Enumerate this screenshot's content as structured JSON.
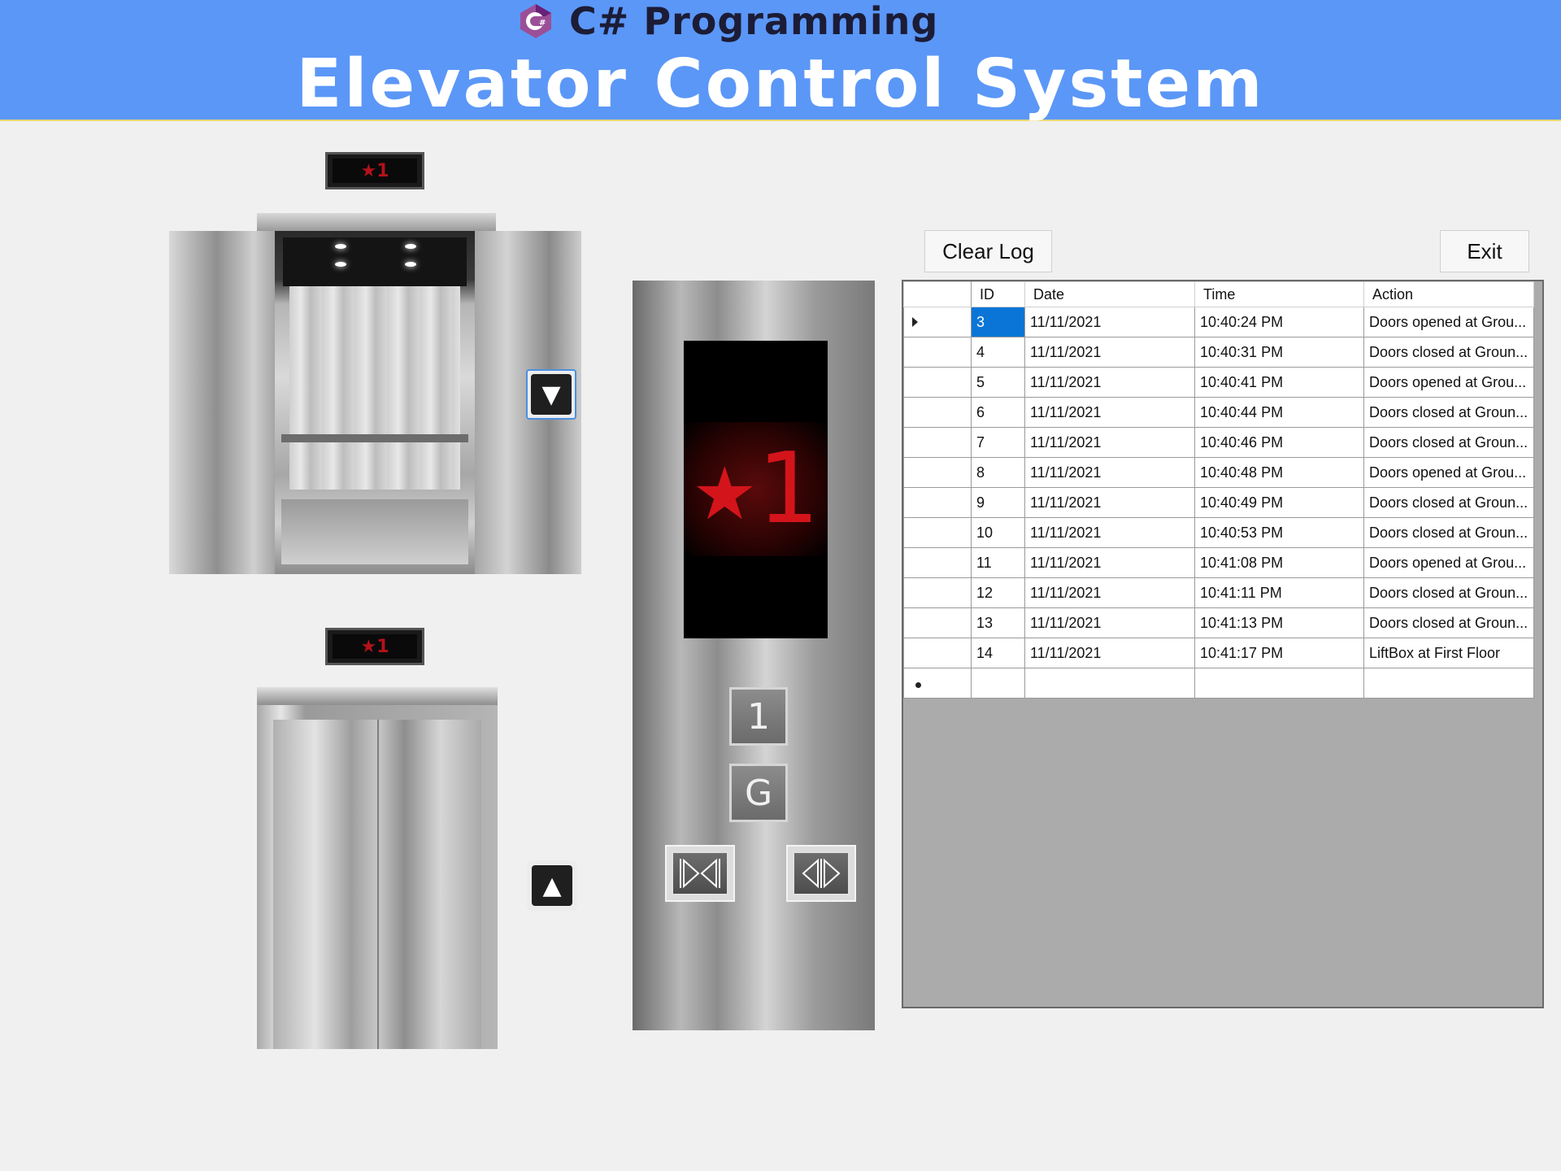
{
  "banner": {
    "subtitle": "C# Programming",
    "title": "Elevator Control System"
  },
  "elevator1": {
    "indicator": "★1"
  },
  "elevator2": {
    "indicator": "★1"
  },
  "call_buttons": {
    "down_label": "▼",
    "up_label": "▲"
  },
  "panel": {
    "display_star": "★",
    "display_floor": "1",
    "floor1_label": "1",
    "ground_label": "G"
  },
  "toolbar": {
    "clear_log_label": "Clear Log",
    "exit_label": "Exit"
  },
  "log": {
    "headers": {
      "id": "ID",
      "date": "Date",
      "time": "Time",
      "action": "Action"
    },
    "rows": [
      {
        "id": "3",
        "date": "11/11/2021",
        "time": "10:40:24 PM",
        "action": "Doors opened at Grou..."
      },
      {
        "id": "4",
        "date": "11/11/2021",
        "time": "10:40:31 PM",
        "action": "Doors closed at Groun..."
      },
      {
        "id": "5",
        "date": "11/11/2021",
        "time": "10:40:41 PM",
        "action": "Doors opened at Grou..."
      },
      {
        "id": "6",
        "date": "11/11/2021",
        "time": "10:40:44 PM",
        "action": "Doors closed at Groun..."
      },
      {
        "id": "7",
        "date": "11/11/2021",
        "time": "10:40:46 PM",
        "action": "Doors closed at Groun..."
      },
      {
        "id": "8",
        "date": "11/11/2021",
        "time": "10:40:48 PM",
        "action": "Doors opened at Grou..."
      },
      {
        "id": "9",
        "date": "11/11/2021",
        "time": "10:40:49 PM",
        "action": "Doors closed at Groun..."
      },
      {
        "id": "10",
        "date": "11/11/2021",
        "time": "10:40:53 PM",
        "action": "Doors closed at Groun..."
      },
      {
        "id": "11",
        "date": "11/11/2021",
        "time": "10:41:08 PM",
        "action": "Doors opened at Grou..."
      },
      {
        "id": "12",
        "date": "11/11/2021",
        "time": "10:41:11 PM",
        "action": "Doors closed at Groun..."
      },
      {
        "id": "13",
        "date": "11/11/2021",
        "time": "10:41:13 PM",
        "action": "Doors closed at Groun..."
      },
      {
        "id": "14",
        "date": "11/11/2021",
        "time": "10:41:17 PM",
        "action": "LiftBox at First Floor"
      }
    ]
  },
  "icons": {
    "logo": "csharp-logo-icon",
    "close_doors": "close-doors-icon",
    "open_doors": "open-doors-icon",
    "down": "arrow-down-icon",
    "up": "arrow-up-icon"
  },
  "colors": {
    "banner": "#5b97f7",
    "selection": "#0a75d6",
    "display_red": "#d4141b"
  }
}
